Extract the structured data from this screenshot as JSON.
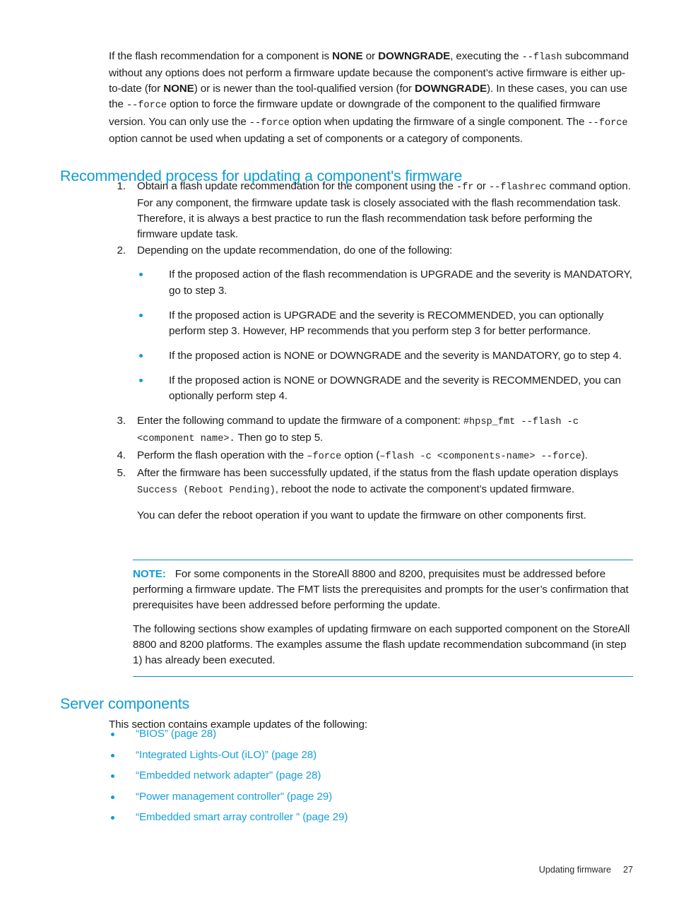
{
  "document": {
    "page_number": "27",
    "footer_label": "Updating firmware"
  },
  "intro": {
    "s1": "If the flash recommendation for a component is ",
    "b1": "NONE",
    "s2": " or ",
    "b2": "DOWNGRADE",
    "s3": ", executing the ",
    "c1": "--flash",
    "s4": " subcommand without any options does not perform a firmware update because the component’s active firmware is either up-to-date (for ",
    "b3": "NONE",
    "s5": ") or is newer than the tool-qualified version (for ",
    "b4": "DOWNGRADE",
    "s6": "). In these cases, you can use the ",
    "c2": "--force",
    "s7": " option to force the firmware update or downgrade of the component to the qualified firmware version. You can only use the ",
    "c3": "--force",
    "s8": " option when updating the firmware of a single component. The ",
    "c4": "--force",
    "s9": " option cannot be used when updating a set of components or a category of components."
  },
  "headings": {
    "recommended_process": "Recommended process for updating a component's firmware",
    "server_components": "Server components"
  },
  "steps": {
    "n1": "1.",
    "n2": "2.",
    "n3": "3.",
    "n4": "4.",
    "n5": "5.",
    "step1": {
      "s1": "Obtain a flash update recommendation for the component using the ",
      "c1": "-fr",
      "s2": " or ",
      "c2": "--flashrec",
      "s3": " command option. For any component, the firmware update task is closely associated with the flash recommendation task. Therefore, it is always a best practice to run the flash recommendation task before performing the firmware update task."
    },
    "step2": {
      "text": "Depending on the update recommendation, do one of the following:",
      "bullets": [
        "If the proposed action of the flash recommendation is UPGRADE and the severity is MANDATORY, go to step 3.",
        "If the proposed action is UPGRADE and the severity is RECOMMENDED, you can optionally perform step 3. However, HP recommends that you perform step 3 for better performance.",
        "If the proposed action is NONE or DOWNGRADE and the severity is MANDATORY, go to step 4.",
        "If the proposed action is NONE or DOWNGRADE and the severity is RECOMMENDED, you can optionally perform step 4."
      ]
    },
    "step3": {
      "s1": "Enter the following command to update the firmware of a component: ",
      "c1": "#hpsp_fmt --flash -c <component name>.",
      "s2": " Then go to step 5."
    },
    "step4": {
      "s1": "Perform the flash operation with the ",
      "c1": "–force",
      "s2": " option (",
      "c2": "–flash -c <components-name> --force",
      "s3": ")."
    },
    "step5": {
      "s1": "After the firmware has been successfully updated, if the status from the flash update operation displays ",
      "c1": "Success (Reboot Pending)",
      "s2": ", reboot the node to activate the component’s updated firmware.",
      "followup": "You can defer the reboot operation if you want to update the firmware on other components first."
    }
  },
  "note": {
    "label": "NOTE:",
    "paragraph1": "For some components in the StoreAll 8800 and 8200, prequisites must be addressed before performing a firmware update. The FMT lists the prerequisites and prompts for the user’s confirmation that prerequisites have been addressed before performing the update.",
    "paragraph2": "The following sections show examples of updating firmware on each supported component on the StoreAll 8800 and 8200 platforms. The examples assume the flash update recommendation subcommand (in step 1) has already been executed."
  },
  "server_components": {
    "intro": "This section contains example updates of the following:",
    "links": [
      "“BIOS” (page 28)",
      "“Integrated Lights-Out (iLO)” (page 28)",
      "“Embedded network adapter” (page 28)",
      "“Power management controller” (page 29)",
      "“Embedded smart array controller ” (page 29)"
    ]
  },
  "colors": {
    "heading_blue": "#0f9bd7",
    "link_blue": "#18a0da",
    "rule_blue": "#0f8cc8",
    "text": "#1d1d1d"
  }
}
